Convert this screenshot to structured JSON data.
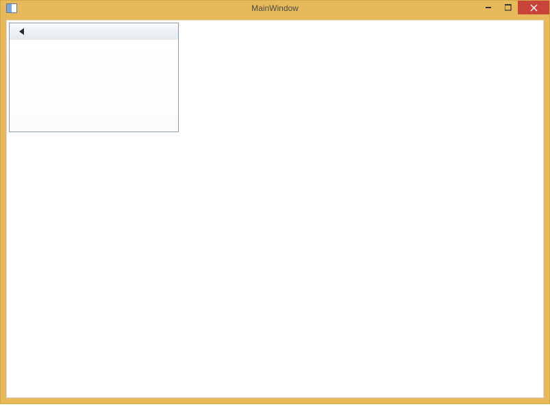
{
  "window": {
    "title": "MainWindow"
  },
  "controls": {
    "minimize_tooltip": "Minimize",
    "maximize_tooltip": "Maximize",
    "close_tooltip": "Close"
  },
  "panel": {
    "back_label": "Back"
  }
}
